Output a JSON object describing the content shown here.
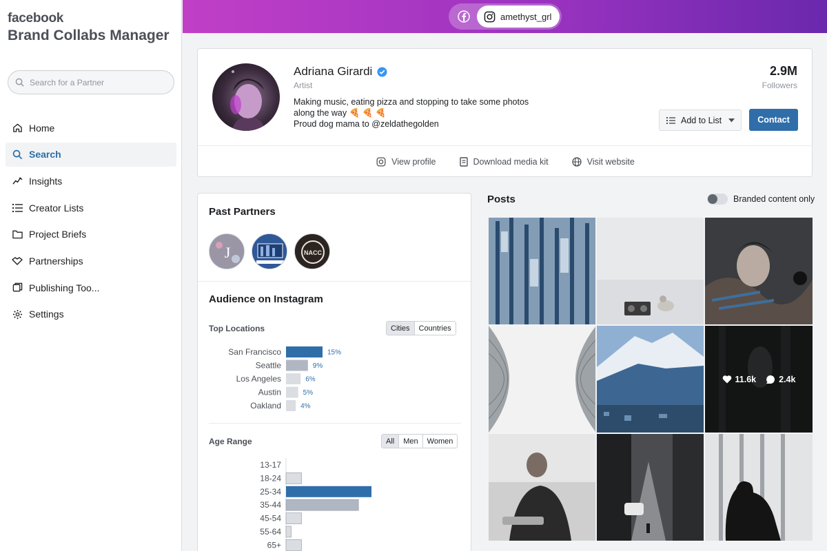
{
  "brand": "facebook",
  "app_title": "Brand Collabs Manager",
  "search": {
    "placeholder": "Search for a Partner"
  },
  "nav": [
    {
      "label": "Home",
      "icon": "home-icon",
      "active": false
    },
    {
      "label": "Search",
      "icon": "search-icon",
      "active": true
    },
    {
      "label": "Insights",
      "icon": "insights-icon",
      "active": false
    },
    {
      "label": "Creator Lists",
      "icon": "list-icon",
      "active": false
    },
    {
      "label": "Project Briefs",
      "icon": "folder-icon",
      "active": false
    },
    {
      "label": "Partnerships",
      "icon": "handshake-icon",
      "active": false
    },
    {
      "label": "Publishing Too...",
      "icon": "publishing-icon",
      "active": false
    },
    {
      "label": "Settings",
      "icon": "gear-icon",
      "active": false
    }
  ],
  "account_switch": {
    "instagram_handle": "amethyst_grl"
  },
  "profile": {
    "name": "Adriana Girardi",
    "role": "Artist",
    "bio_line1": "Making music, eating pizza and stopping to take some photos",
    "bio_line2": "along the way 🍕 🍕 🍕",
    "bio_line3": "Proud dog mama to @zeldathegolden",
    "followers_count": "2.9M",
    "followers_label": "Followers",
    "add_to_list_label": "Add to List",
    "contact_label": "Contact",
    "links": {
      "view_profile": "View profile",
      "download_media_kit": "Download media kit",
      "visit_website": "Visit website"
    }
  },
  "past_partners": {
    "title": "Past Partners",
    "partner3_text": "NACC"
  },
  "audience": {
    "title": "Audience on Instagram",
    "top_locations": {
      "label": "Top Locations",
      "tabs": [
        "Cities",
        "Countries"
      ],
      "active_tab": "Cities"
    },
    "age_range": {
      "label": "Age Range",
      "tabs": [
        "All",
        "Men",
        "Women"
      ],
      "active_tab": "All"
    }
  },
  "posts": {
    "title": "Posts",
    "branded_label": "Branded content only",
    "hover_likes": "11.6k",
    "hover_comments": "2.4k"
  },
  "colors": {
    "accent": "#2f6ea9",
    "bar_primary": "#2f6ea9",
    "bar_secondary": "#b0b7c3",
    "bar_light": "#dadde1",
    "gradient_start": "#c13fc7",
    "gradient_end": "#6a28ad"
  },
  "chart_data": [
    {
      "type": "bar",
      "title": "Top Locations",
      "categories": [
        "San Francisco",
        "Seattle",
        "Los Angeles",
        "Austin",
        "Oakland"
      ],
      "values": [
        15,
        9,
        6,
        5,
        4
      ],
      "value_labels": [
        "15%",
        "9%",
        "6%",
        "5%",
        "4%"
      ],
      "orientation": "horizontal"
    },
    {
      "type": "bar",
      "title": "Age Range",
      "categories": [
        "13-17",
        "18-24",
        "25-34",
        "35-44",
        "45-54",
        "55-64",
        "65+"
      ],
      "values": [
        0,
        6,
        33,
        28,
        6,
        2,
        6
      ],
      "orientation": "horizontal"
    }
  ]
}
